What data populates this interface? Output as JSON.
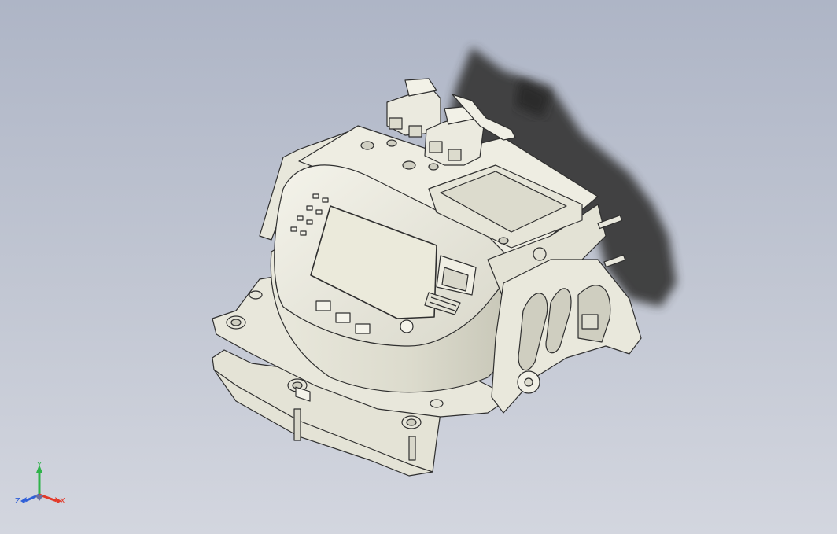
{
  "viewport": {
    "background_top": "#aeb5c6",
    "background_bottom": "#d3d6df",
    "model_fill": "#ecebe0",
    "model_stroke": "#2f2f2f",
    "shadow_color": "#3a3a3a"
  },
  "triad": {
    "x_label": "X",
    "y_label": "Y",
    "z_label": "Z",
    "x_color": "#e23a2a",
    "y_color": "#2fb34a",
    "z_color": "#2f5fd8"
  }
}
